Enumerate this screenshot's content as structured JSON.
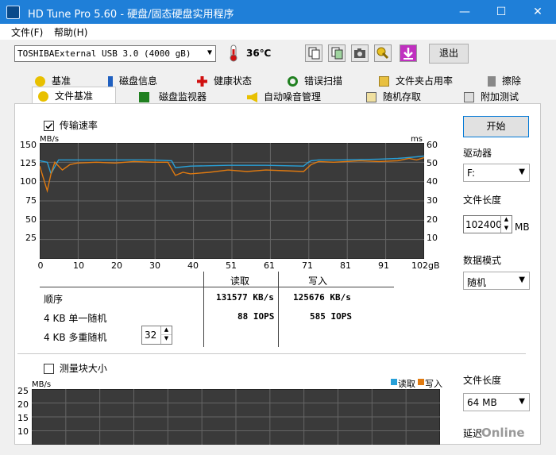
{
  "window": {
    "title": "HD Tune Pro 5.60 - 硬盘/固态硬盘实用程序",
    "minimize": "—",
    "maximize": "☐",
    "close": "✕"
  },
  "menu": {
    "file": "文件(F)",
    "help": "帮助(H)"
  },
  "toolbar": {
    "drive": "TOSHIBAExternal USB 3.0 (4000 gB)",
    "temperature": "36℃",
    "exit": "退出"
  },
  "tabs_row1": [
    "基准",
    "磁盘信息",
    "健康状态",
    "错误扫描",
    "文件夹占用率",
    "擦除"
  ],
  "tabs_row2": [
    "文件基准",
    "磁盘监视器",
    "自动噪音管理",
    "随机存取",
    "附加测试"
  ],
  "transfer": {
    "checkbox_label": "传输速率",
    "left_unit": "MB/s",
    "right_unit": "ms",
    "left_ticks": [
      "150",
      "125",
      "100",
      "75",
      "50",
      "25"
    ],
    "right_ticks": [
      "60",
      "50",
      "40",
      "30",
      "20",
      "10"
    ],
    "bottom_ticks": [
      "0",
      "10",
      "20",
      "30",
      "40",
      "51",
      "61",
      "71",
      "81",
      "91",
      "102gB"
    ]
  },
  "chart_data": {
    "type": "line",
    "xlabel": "",
    "x_range": [
      0,
      102
    ],
    "x_unit": "gB",
    "ylim_left": [
      0,
      150
    ],
    "ylim_right": [
      0,
      60
    ],
    "series": [
      {
        "x": [
          0,
          2,
          3,
          5,
          10,
          20,
          30,
          35,
          36,
          40,
          50,
          60,
          70,
          71,
          72,
          74,
          80,
          90,
          95,
          100,
          102
        ],
        "y": [
          127,
          125,
          110,
          128,
          128,
          128,
          128,
          127,
          118,
          120,
          121,
          121,
          120,
          124,
          127,
          128,
          128,
          129,
          130,
          132,
          133
        ]
      },
      {
        "x": [
          0,
          2,
          3,
          4,
          6,
          8,
          10,
          15,
          20,
          25,
          30,
          34,
          36,
          38,
          40,
          45,
          50,
          55,
          60,
          65,
          70,
          72,
          74,
          78,
          85,
          90,
          95,
          98,
          100,
          102
        ],
        "y": [
          120,
          88,
          110,
          125,
          115,
          122,
          124,
          125,
          124,
          126,
          125,
          125,
          108,
          112,
          110,
          112,
          115,
          113,
          115,
          114,
          113,
          122,
          126,
          125,
          127,
          126,
          127,
          130,
          128,
          131
        ]
      }
    ]
  },
  "results": {
    "col_read": "读取",
    "col_write": "写入",
    "rows": [
      {
        "label": "顺序",
        "read": "131577 KB/s",
        "write": "125676 KB/s"
      },
      {
        "label": "4 KB 单一随机",
        "read": "88 IOPS",
        "write": "585 IOPS"
      },
      {
        "label": "4 KB 多重随机",
        "queue": "32"
      }
    ]
  },
  "right": {
    "start": "开始",
    "drive_label": "驱动器",
    "drive_value": "F:",
    "filelen_label": "文件长度",
    "filelen_value": "102400",
    "filelen_unit": "MB",
    "mode_label": "数据模式",
    "mode_value": "随机"
  },
  "block": {
    "checkbox_label": "测量块大小",
    "unit": "MB/s",
    "ticks": [
      "25",
      "20",
      "15",
      "10"
    ],
    "legend_read": "读取",
    "legend_write": "写入",
    "filelen_label": "文件长度",
    "filelen_value": "64 MB",
    "delay_label": "延迟"
  },
  "watermark": "Online",
  "colors": {
    "read": "#28a0d8",
    "write": "#e07a10",
    "titlebar": "#1f7fd8",
    "chart_bg": "#3a3a3a"
  }
}
